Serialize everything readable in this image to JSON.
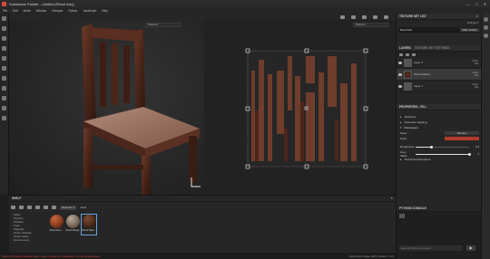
{
  "app": {
    "title": "Substance Painter - Untitled (Read only)"
  },
  "menu": [
    "File",
    "Edit",
    "Mode",
    "Window",
    "Viewport",
    "Python",
    "JavaScript",
    "Help"
  ],
  "viewports": {
    "left_mode": "Material",
    "right_mode": "Material"
  },
  "texture_set_list": {
    "header": "TEXTURE SET LIST",
    "settings": "Settings ▾",
    "item": "BandAid2",
    "shader_btn": "Main shader"
  },
  "layers": {
    "header": "LAYERS",
    "tab2": "TEXTURE SET SETTINGS",
    "items": [
      {
        "name": "Layer 2",
        "blend": "Norm",
        "opacity": "100"
      },
      {
        "name": "Wood Walnut",
        "blend": "Norm",
        "opacity": "100"
      },
      {
        "name": "Layer 1",
        "blend": "Norm",
        "opacity": "100"
      }
    ]
  },
  "properties": {
    "header": "PROPERTIES - FILL",
    "sections": [
      "Attributes",
      "Channels mapping",
      "Parameters"
    ],
    "seed_label": "Seed",
    "seed_value": "Random",
    "color_label": "Color",
    "color_hex": "#b33a2a",
    "roughness_label": "Roughness",
    "roughness_value": "0.3",
    "roughness_frac": 0.3,
    "grey_label": "Grey Value",
    "grey_value": "1",
    "grey_frac": 1.0,
    "tech_section": "Technical Parameters"
  },
  "shelf": {
    "header": "SHELF",
    "search": "wood",
    "categories": [
      "Filters",
      "Brushes",
      "Particles",
      "Tools",
      "Materials",
      "Smart materials",
      "Smart masks",
      "Environments"
    ],
    "materials": [
      {
        "name": "Wood Ame...",
        "color": "#8a3a1e"
      },
      {
        "name": "Wood Rough",
        "color": "#7a6a5a"
      },
      {
        "name": "Wood Waln...",
        "color": "#4a2a1a"
      }
    ]
  },
  "python": {
    "header": "PYTHON CONSOLE",
    "placeholder": "Execute Python command",
    "run": "▶"
  },
  "status": {
    "error": "[Scene 3D] Mesh provided doesn't seem to have UV coordinates. UV will be generated.",
    "gpu": "Cache Disk Usage: 96% | Version: 7.2.3"
  }
}
